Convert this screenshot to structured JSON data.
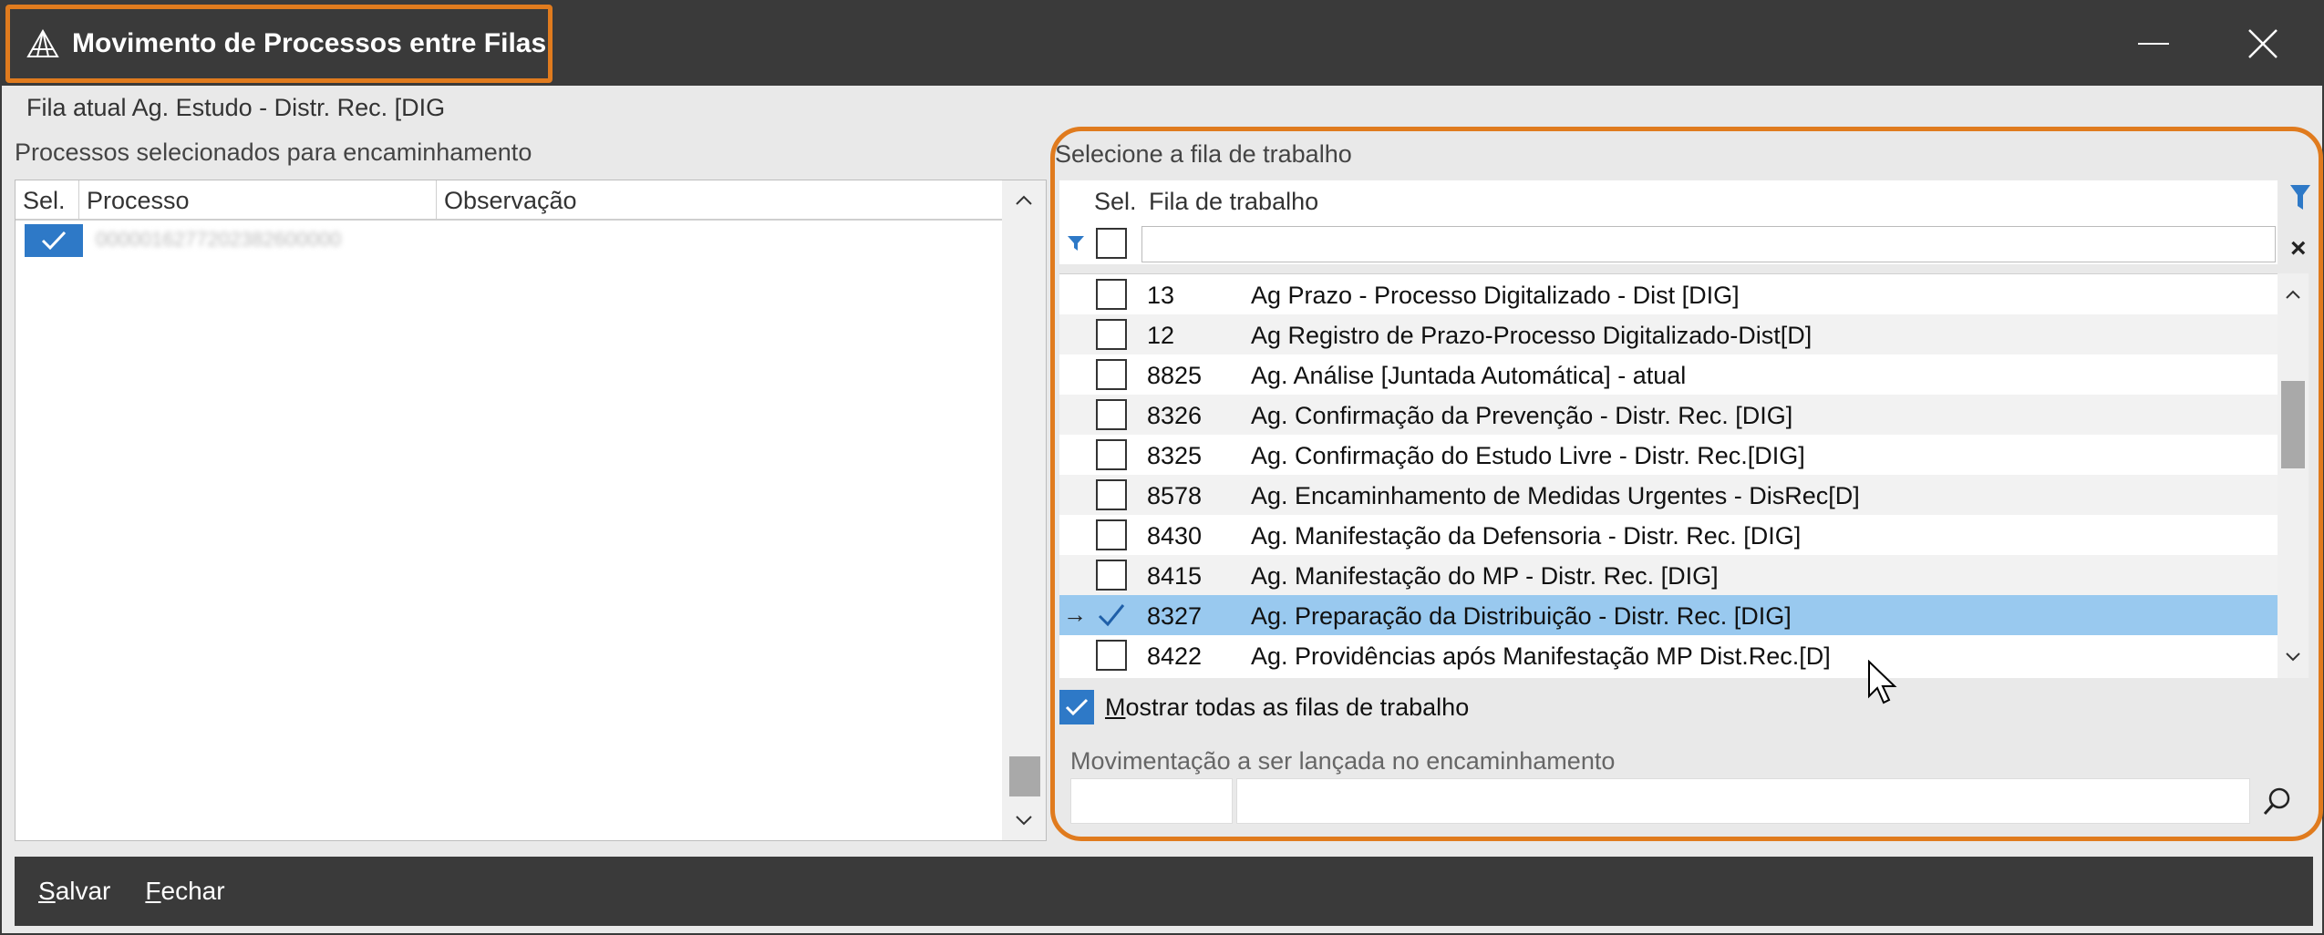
{
  "window": {
    "title": "Movimento de Processos entre Filas",
    "minimize_icon": "minimize-icon",
    "close_icon": "close-icon"
  },
  "current_queue": {
    "label": "Fila atual",
    "value": "Ag. Estudo - Distr. Rec. [DIG"
  },
  "left_panel": {
    "caption": "Processos selecionados para encaminhamento",
    "columns": [
      "Sel.",
      "Processo",
      "Observação"
    ],
    "rows": [
      {
        "selected": true,
        "process": "0000016277202382600000",
        "observation": ""
      }
    ]
  },
  "right_panel": {
    "caption": "Selecione a fila de trabalho",
    "columns": [
      "Sel.",
      "Fila de trabalho"
    ],
    "filter_value": "",
    "queues": [
      {
        "id": "13",
        "name": "Ag Prazo - Processo Digitalizado - Dist [DIG]",
        "checked": false
      },
      {
        "id": "12",
        "name": "Ag Registro de Prazo-Processo Digitalizado-Dist[D]",
        "checked": false
      },
      {
        "id": "8825",
        "name": "Ag. Análise [Juntada Automática] - atual",
        "checked": false
      },
      {
        "id": "8326",
        "name": "Ag. Confirmação da Prevenção - Distr. Rec. [DIG]",
        "checked": false
      },
      {
        "id": "8325",
        "name": "Ag. Confirmação do Estudo Livre - Distr. Rec.[DIG]",
        "checked": false
      },
      {
        "id": "8578",
        "name": "Ag. Encaminhamento de Medidas Urgentes - DisRec[D]",
        "checked": false
      },
      {
        "id": "8430",
        "name": "Ag. Manifestação da Defensoria - Distr. Rec. [DIG]",
        "checked": false
      },
      {
        "id": "8415",
        "name": "Ag. Manifestação do MP - Distr. Rec. [DIG]",
        "checked": false
      },
      {
        "id": "8327",
        "name": "Ag. Preparação da Distribuição - Distr. Rec. [DIG]",
        "checked": true,
        "current": true
      },
      {
        "id": "8422",
        "name": "Ag. Providências após Manifestação MP Dist.Rec.[D]",
        "checked": false
      }
    ],
    "show_all": {
      "checked": true,
      "label_prefix": "M",
      "label_rest": "ostrar todas as filas de trabalho"
    },
    "movement": {
      "caption": "Movimentação a ser lançada no encaminhamento",
      "code": "",
      "description": ""
    }
  },
  "footer": {
    "save_prefix": "S",
    "save_rest": "alvar",
    "close_prefix": "F",
    "close_rest": "echar"
  },
  "colors": {
    "titlebar": "#3a3a3a",
    "highlight_outline": "#e07b1e",
    "accent": "#2e79c7",
    "selected_row": "#99c9ef"
  }
}
